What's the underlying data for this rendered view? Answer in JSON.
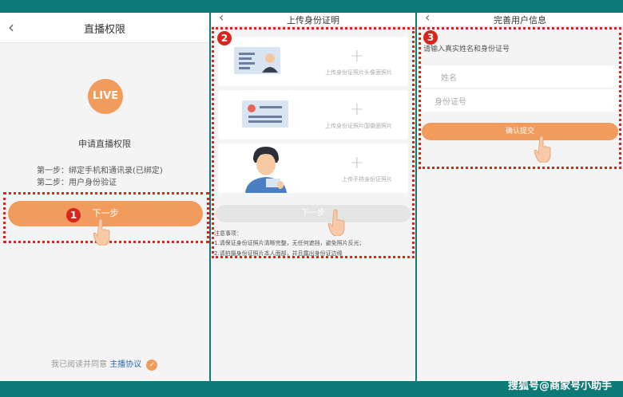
{
  "screen1": {
    "back_icon": "chevron-left-icon",
    "title": "直播权限",
    "live_badge": "LIVE",
    "apply_label": "申请直播权限",
    "step1": "第一步：绑定手机和通讯录(已绑定)",
    "step2": "第二步：用户身份验证",
    "next_button": "下一步",
    "agreement_prefix": "我已阅读并同意",
    "agreement_link": "主播协议",
    "step_number": "1",
    "accent_color": "#f19b5c"
  },
  "screen2": {
    "back_icon": "chevron-left-icon",
    "title": "上传身份证明",
    "step_number": "2",
    "cards": [
      {
        "label": "上传身份证照片头像面照片"
      },
      {
        "label": "上传身份证照片国徽面照片"
      },
      {
        "label": "上传手持身份证照片"
      }
    ],
    "next_button": "下一步",
    "notes_title": "注意事项：",
    "note1": "1.请保证身份证照片清晰完整，无任何遮挡，避免照片反光；",
    "note2": "2.请拍摄身份证照片本人面部，并且露出身份证边缘"
  },
  "screen3": {
    "back_icon": "chevron-left-icon",
    "title": "完善用户信息",
    "step_number": "3",
    "instruction": "请输入真实姓名和身份证号",
    "name_placeholder": "姓名",
    "id_placeholder": "身份证号",
    "confirm_button": "确认提交"
  },
  "watermark": "搜狐号@商家号小助手"
}
